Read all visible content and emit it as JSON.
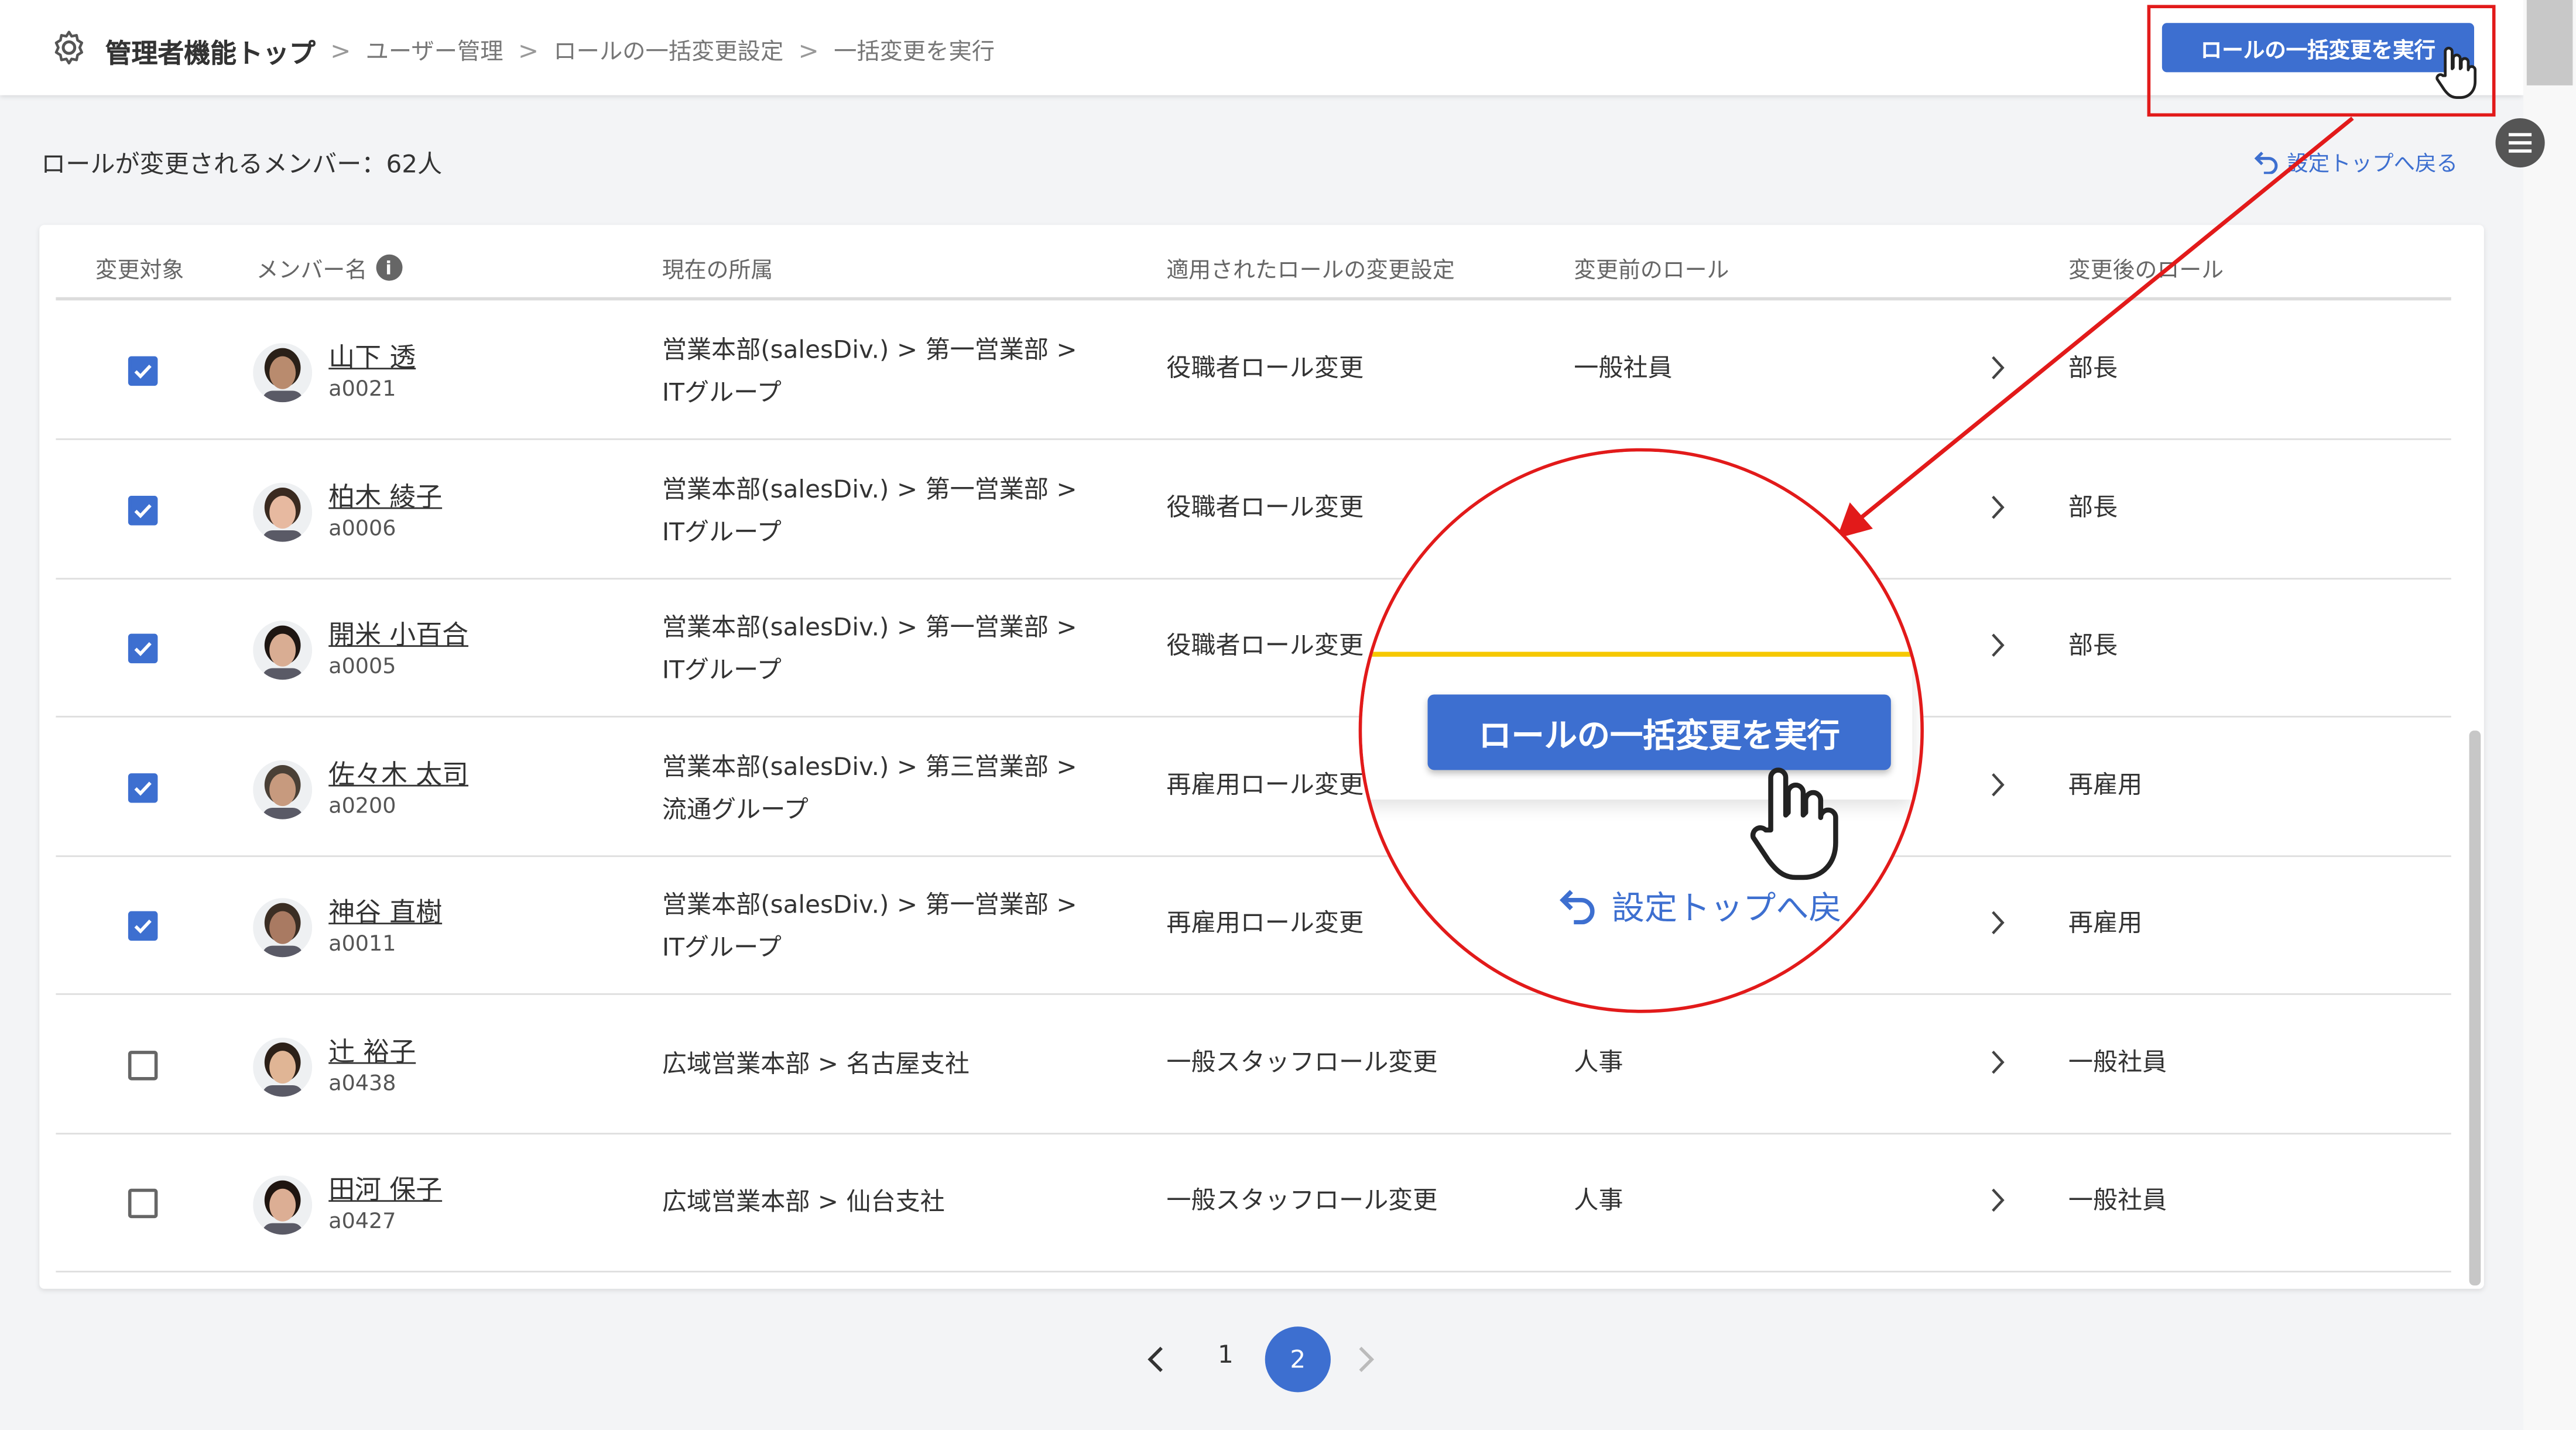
{
  "header": {
    "breadcrumb": {
      "home": "管理者機能トップ",
      "item1": "ユーザー管理",
      "item2": "ロールの一括変更設定",
      "item3": "一括変更を実行"
    },
    "execute_label": "ロールの一括変更を実行"
  },
  "summary": {
    "member_count_label": "ロールが変更されるメンバー：62人",
    "back_link": "設定トップへ戻る"
  },
  "table": {
    "headers": {
      "target": "変更対象",
      "member": "メンバー名",
      "dept": "現在の所属",
      "setting": "適用されたロールの変更設定",
      "before": "変更前のロール",
      "after": "変更後のロール"
    },
    "rows": [
      {
        "checked": true,
        "name": "山下 透",
        "id": "a0021",
        "dept1": "営業本部(salesDiv.) > 第一営業部 >",
        "dept2": "ITグループ",
        "setting": "役職者ロール変更",
        "before": "一般社員",
        "after": "部長"
      },
      {
        "checked": true,
        "name": "柏木 綾子",
        "id": "a0006",
        "dept1": "営業本部(salesDiv.) > 第一営業部 >",
        "dept2": "ITグループ",
        "setting": "役職者ロール変更",
        "before": "",
        "after": "部長"
      },
      {
        "checked": true,
        "name": "開米 小百合",
        "id": "a0005",
        "dept1": "営業本部(salesDiv.) > 第一営業部 >",
        "dept2": "ITグループ",
        "setting": "役職者ロール変更",
        "before": "",
        "after": "部長"
      },
      {
        "checked": true,
        "name": "佐々木 太司",
        "id": "a0200",
        "dept1": "営業本部(salesDiv.) > 第三営業部 >",
        "dept2": "流通グループ",
        "setting": "再雇用ロール変更",
        "before": "",
        "after": "再雇用"
      },
      {
        "checked": true,
        "name": "神谷 直樹",
        "id": "a0011",
        "dept1": "営業本部(salesDiv.) > 第一営業部 >",
        "dept2": "ITグループ",
        "setting": "再雇用ロール変更",
        "before": "",
        "after": "再雇用"
      },
      {
        "checked": false,
        "name": "辻 裕子",
        "id": "a0438",
        "dept1": "広域営業本部 > 名古屋支社",
        "dept2": "",
        "setting": "一般スタッフロール変更",
        "before": "人事",
        "after": "一般社員"
      },
      {
        "checked": false,
        "name": "田河 保子",
        "id": "a0427",
        "dept1": "広域営業本部 > 仙台支社",
        "dept2": "",
        "setting": "一般スタッフロール変更",
        "before": "人事",
        "after": "一般社員"
      }
    ]
  },
  "pagination": {
    "page1": "1",
    "page2": "2",
    "current": 2
  },
  "magnifier": {
    "button_label": "ロールの一括変更を実行",
    "link_label": "設定トップへ戻"
  },
  "colors": {
    "accent": "#3d6fd0",
    "highlight": "#e21a1a",
    "yellow": "#f6c800"
  },
  "icons": [
    "gear-icon",
    "info-icon",
    "undo-icon",
    "chevron-right-icon",
    "chevron-left-icon",
    "hand-pointer-icon",
    "hamburger-icon",
    "check-icon"
  ]
}
